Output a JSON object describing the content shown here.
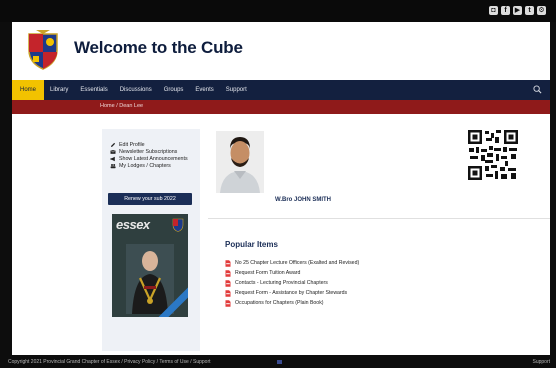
{
  "site": {
    "title": "Welcome to the Cube"
  },
  "social": [
    {
      "icon": "instagram-icon",
      "glyph": "◘"
    },
    {
      "icon": "facebook-icon",
      "glyph": "f"
    },
    {
      "icon": "youtube-icon",
      "glyph": "▶"
    },
    {
      "icon": "twitter-icon",
      "glyph": "t"
    },
    {
      "icon": "gear-icon",
      "glyph": "⚙"
    }
  ],
  "nav": {
    "items": [
      "Home",
      "Library",
      "Essentials",
      "Discussions",
      "Groups",
      "Events",
      "Support"
    ],
    "active": "Home"
  },
  "breadcrumb": "Home  /  Dean Lee",
  "sidebar": {
    "menu": [
      {
        "label": "Edit Profile",
        "icon": "pencil-icon"
      },
      {
        "label": "Newsletter Subscriptions",
        "icon": "envelope-icon"
      },
      {
        "label": "Show Latest Announcements",
        "icon": "megaphone-icon"
      },
      {
        "label": "My Lodges / Chapters",
        "icon": "group-icon"
      }
    ],
    "renew_button": "Renew your sub 2022",
    "magazine": {
      "title": "essex"
    }
  },
  "profile": {
    "name": "W.Bro JOHN SMITH"
  },
  "popular": {
    "title": "Popular Items",
    "items": [
      "No 25 Chapter Lecture Officers (Exalted and Revised)",
      "Request Form Tuition Award",
      "Contacts - Lecturing Provincial Chapters",
      "Request Form - Assistance by Chapter Stewards",
      "Occupations for Chapters (Plain Book)"
    ]
  },
  "footer": {
    "text": "Copyright 2021 Provincial Grand Chapter of Essex / Privacy Policy / Terms of Use / Support",
    "right": "Support"
  },
  "colors": {
    "navy": "#13203f",
    "gold": "#f2c200",
    "maroon": "#8f1a1a"
  }
}
